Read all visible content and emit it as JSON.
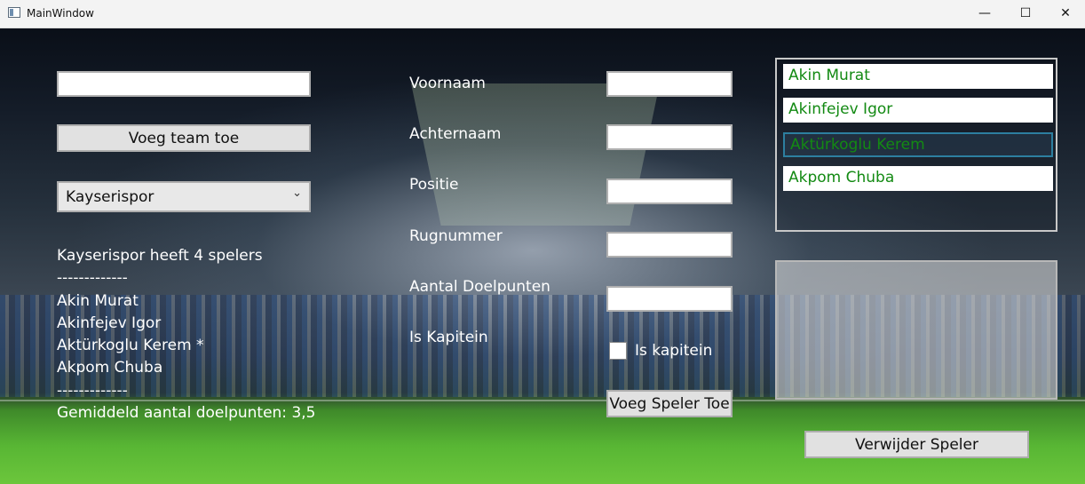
{
  "window": {
    "title": "MainWindow",
    "minimize_glyph": "—",
    "maximize_glyph": "☐",
    "close_glyph": "✕"
  },
  "left": {
    "team_input_value": "",
    "add_team_button": "Voeg team toe",
    "team_select": "Kayserispor",
    "summary_lines": [
      "Kayserispor heeft 4 spelers",
      "-------------",
      "Akin Murat",
      "Akinfejev Igor",
      "Aktürkoglu Kerem *",
      "Akpom Chuba",
      "-------------",
      "Gemiddeld aantal doelpunten: 3,5"
    ]
  },
  "form": {
    "firstname_label": "Voornaam",
    "lastname_label": "Achternaam",
    "position_label": "Positie",
    "number_label": "Rugnummer",
    "goals_label": "Aantal Doelpunten",
    "captain_label": "Is Kapitein",
    "captain_checkbox_label": "Is kapitein",
    "add_player_button": "Voeg Speler Toe"
  },
  "players": {
    "items": [
      {
        "name": "Akin Murat"
      },
      {
        "name": "Akinfejev Igor"
      },
      {
        "name": "Aktürkoglu Kerem"
      },
      {
        "name": "Akpom Chuba"
      }
    ],
    "remove_button": "Verwijder Speler"
  }
}
